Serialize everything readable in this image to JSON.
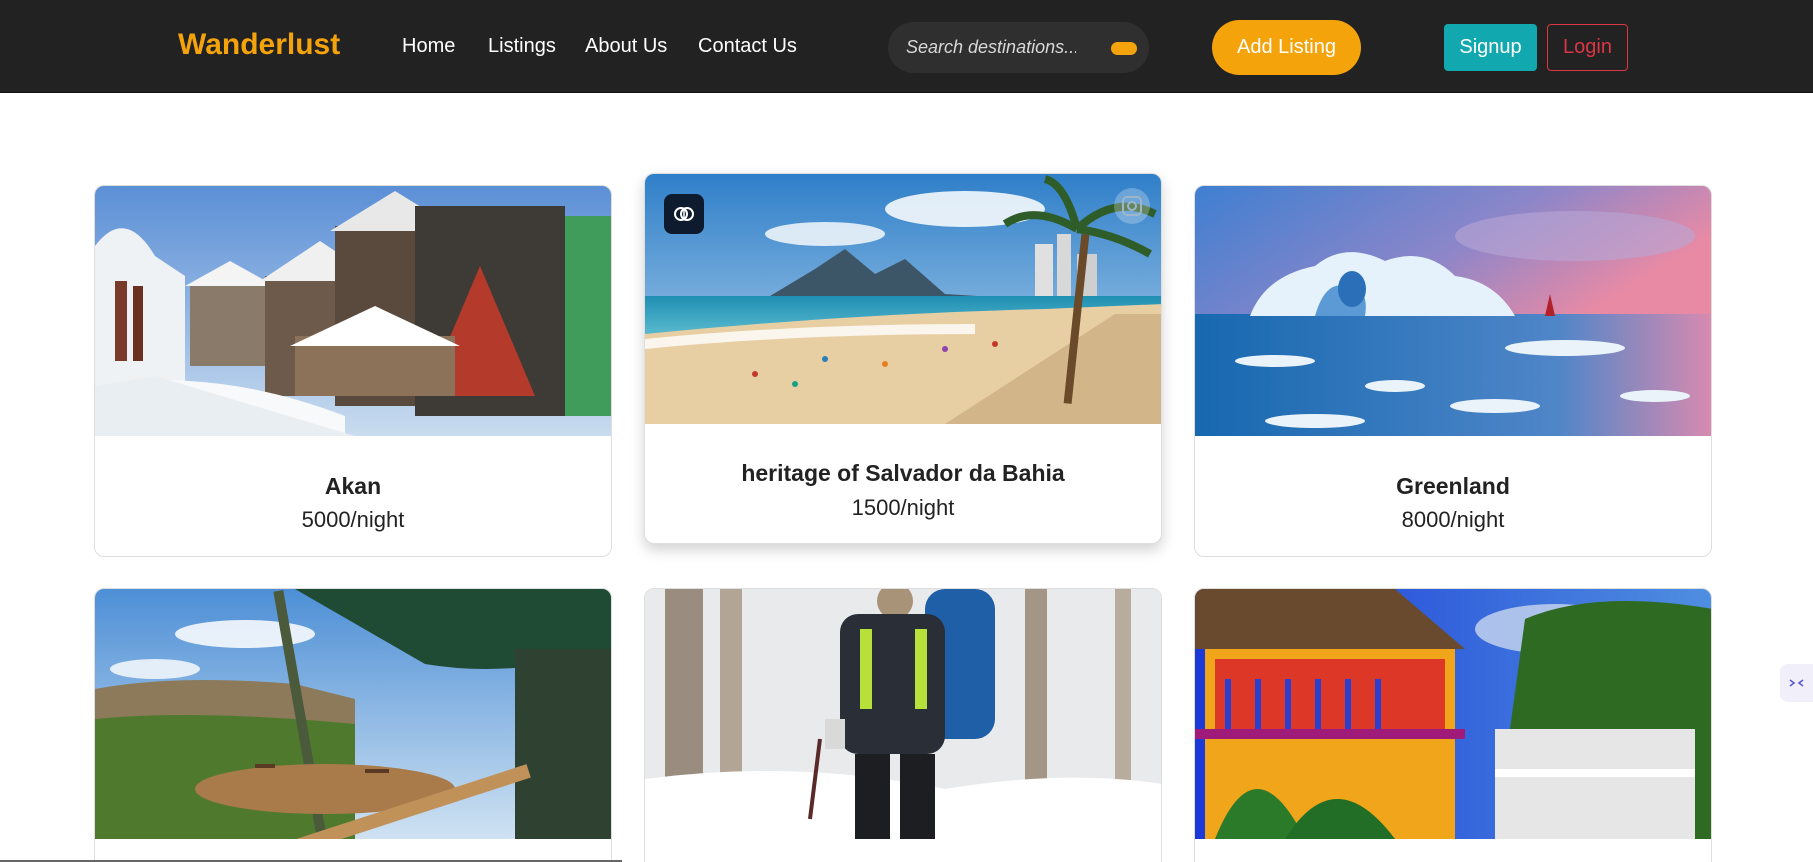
{
  "navbar": {
    "brand": "Wanderlust",
    "links": [
      "Home",
      "Listings",
      "About Us",
      "Contact Us"
    ],
    "search": {
      "placeholder": "Search destinations..."
    },
    "add_listing": "Add Listing",
    "signup": "Signup",
    "login": "Login",
    "colors": {
      "background": "#222222",
      "accent": "#f5a30b",
      "signup": "#12a8b0",
      "login": "#dc3545"
    }
  },
  "listings": [
    {
      "title": "Akan",
      "price": "5000/night",
      "image": "snowy-village-photo"
    },
    {
      "title": "heritage of Salvador da Bahia",
      "price": "1500/night",
      "image": "beach-mountains-photo"
    },
    {
      "title": "Greenland",
      "price": "8000/night",
      "image": "iceberg-photo"
    },
    {
      "title": "",
      "price": "",
      "image": "safari-tent-photo"
    },
    {
      "title": "",
      "price": "",
      "image": "snow-hikers-photo"
    },
    {
      "title": "",
      "price": "",
      "image": "colorful-house-photo"
    }
  ]
}
